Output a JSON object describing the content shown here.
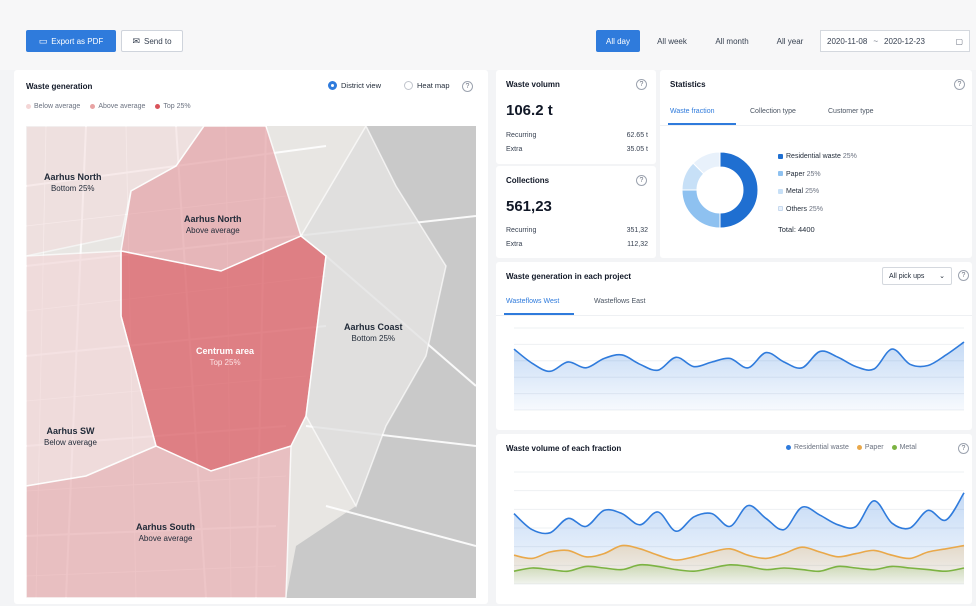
{
  "toolbar": {
    "export_label": "Export as PDF",
    "send_label": "Send to",
    "periods": [
      "All day",
      "All week",
      "All month",
      "All year"
    ],
    "active_period": "All day",
    "date_from": "2020-11-08",
    "date_to": "2020-12-23"
  },
  "waste_generation": {
    "title": "Waste generation",
    "view_district": "District view",
    "view_heat": "Heat map",
    "legend": [
      "Below average",
      "Above average",
      "Top 25%"
    ],
    "regions": [
      {
        "name": "Aarhus North",
        "sub": "Bottom 25%"
      },
      {
        "name": "Aarhus North",
        "sub": "Above average"
      },
      {
        "name": "Centrum area",
        "sub": "Top 25%"
      },
      {
        "name": "Aarhus Coast",
        "sub": "Bottom 25%"
      },
      {
        "name": "Aarhus SW",
        "sub": "Below average"
      },
      {
        "name": "Aarhus South",
        "sub": "Above average"
      }
    ]
  },
  "waste_volume": {
    "title": "Waste volumn",
    "value": "106.2 t",
    "rows": [
      {
        "label": "Recurring",
        "value": "62.65 t"
      },
      {
        "label": "Extra",
        "value": "35.05 t"
      }
    ]
  },
  "collections": {
    "title": "Collections",
    "value": "561,23",
    "rows": [
      {
        "label": "Recurring",
        "value": "351,32"
      },
      {
        "label": "Extra",
        "value": "112,32"
      }
    ]
  },
  "statistics": {
    "title": "Statistics",
    "tabs": [
      "Waste fraction",
      "Collection type",
      "Customer type"
    ],
    "active_tab": "Waste fraction",
    "donut": [
      {
        "label": "Residential waste",
        "pct": "25%",
        "value": 50,
        "color": "#1f6fd1"
      },
      {
        "label": "Paper",
        "pct": "25%",
        "value": 25,
        "color": "#8ec1f0"
      },
      {
        "label": "Metal",
        "pct": "25%",
        "value": 12.5,
        "color": "#c7e0f7"
      },
      {
        "label": "Others",
        "pct": "25%",
        "value": 12.5,
        "color": "#e8f1fb"
      }
    ],
    "total": "Total: 4400"
  },
  "project_chart": {
    "title": "Waste generation in each project",
    "dropdown": "All pick ups",
    "tabs": [
      "Wasteflows West",
      "Wasteflows East"
    ],
    "active_tab": "Wasteflows West",
    "chart_data": {
      "type": "area",
      "series": [
        {
          "values": [
            52,
            40,
            33,
            41,
            36,
            44,
            47,
            39,
            34,
            45,
            37,
            41,
            44,
            36,
            49,
            41,
            36,
            50,
            45,
            37,
            35,
            52,
            39,
            38,
            47,
            58
          ]
        }
      ]
    }
  },
  "fraction_chart": {
    "title": "Waste volume of each fraction",
    "legend": [
      "Residential waste",
      "Paper",
      "Metal"
    ],
    "chart_data": {
      "type": "area",
      "series": [
        {
          "name": "Residential waste",
          "color": "#2f7bdc",
          "values": [
            44,
            34,
            32,
            41,
            36,
            46,
            44,
            37,
            45,
            33,
            42,
            44,
            36,
            49,
            41,
            34,
            48,
            43,
            37,
            36,
            52,
            38,
            35,
            46,
            40,
            57
          ]
        },
        {
          "name": "Paper",
          "color": "#e9a84a",
          "values": [
            18,
            16,
            20,
            21,
            17,
            19,
            24,
            22,
            18,
            15,
            17,
            20,
            22,
            18,
            16,
            19,
            23,
            20,
            17,
            19,
            21,
            18,
            16,
            20,
            22,
            24
          ]
        },
        {
          "name": "Metal",
          "color": "#7cb342",
          "values": [
            8,
            10,
            9,
            8,
            11,
            10,
            9,
            12,
            11,
            9,
            8,
            10,
            12,
            11,
            9,
            10,
            9,
            8,
            11,
            10,
            9,
            11,
            10,
            9,
            8,
            10
          ]
        }
      ]
    }
  }
}
